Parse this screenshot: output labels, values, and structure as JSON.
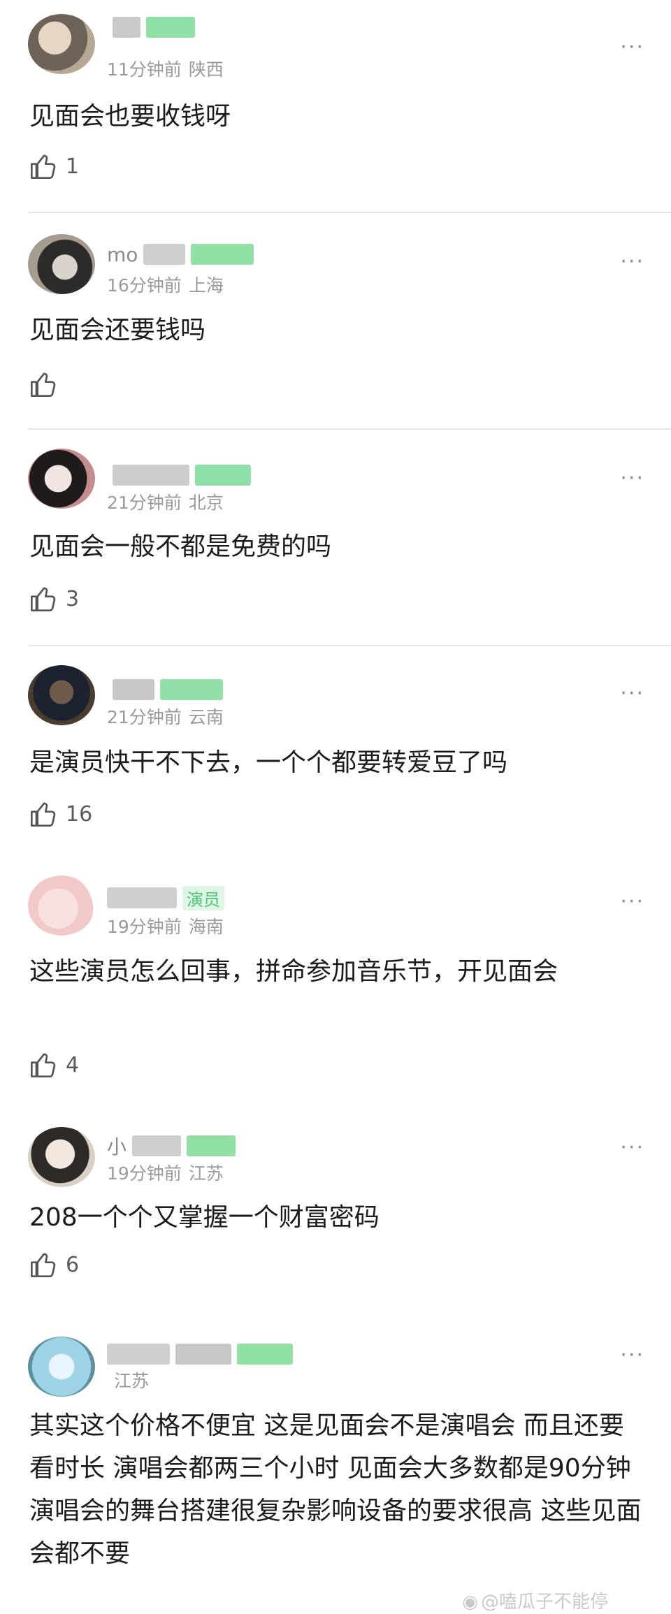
{
  "comments": [
    {
      "user": "",
      "badge": "",
      "time": "11分钟前",
      "location": "陕西",
      "text": "见面会也要收钱呀",
      "likes": "1"
    },
    {
      "user": "mo",
      "badge": "",
      "time": "16分钟前",
      "location": "上海",
      "text": "见面会还要钱吗",
      "likes": ""
    },
    {
      "user": "",
      "badge": "",
      "time": "21分钟前",
      "location": "北京",
      "text": "见面会一般不都是免费的吗",
      "likes": "3"
    },
    {
      "user": "",
      "badge": "",
      "time": "21分钟前",
      "location": "云南",
      "text": "是演员快干不下去，一个个都要转爱豆了吗",
      "likes": "16"
    },
    {
      "user": "",
      "badge": "演员",
      "time": "19分钟前",
      "location": "海南",
      "text": "这些演员怎么回事，拼命参加音乐节，开见面会",
      "likes": "4"
    },
    {
      "user": "小",
      "badge": "",
      "time": "19分钟前",
      "location": "江苏",
      "text": "208一个个又掌握一个财富密码",
      "likes": "6"
    },
    {
      "user": "",
      "badge": "",
      "time": "",
      "location": "江苏",
      "text": "其实这个价格不便宜 这是见面会不是演唱会 而且还要看时长 演唱会都两三个小时 见面会大多数都是90分钟 演唱会的舞台搭建很复杂影响设备的要求很高 这些见面会都不要",
      "likes": ""
    }
  ],
  "more_icon": "···",
  "watermark": "@嗑瓜子不能停",
  "icons": {
    "like": "thumbs-up-icon",
    "more": "more-dots-icon",
    "weibo": "weibo-icon"
  },
  "colors": {
    "badge_green": "#59c77f",
    "meta_gray": "#9a9a9a",
    "divider": "#e6e6e6"
  }
}
